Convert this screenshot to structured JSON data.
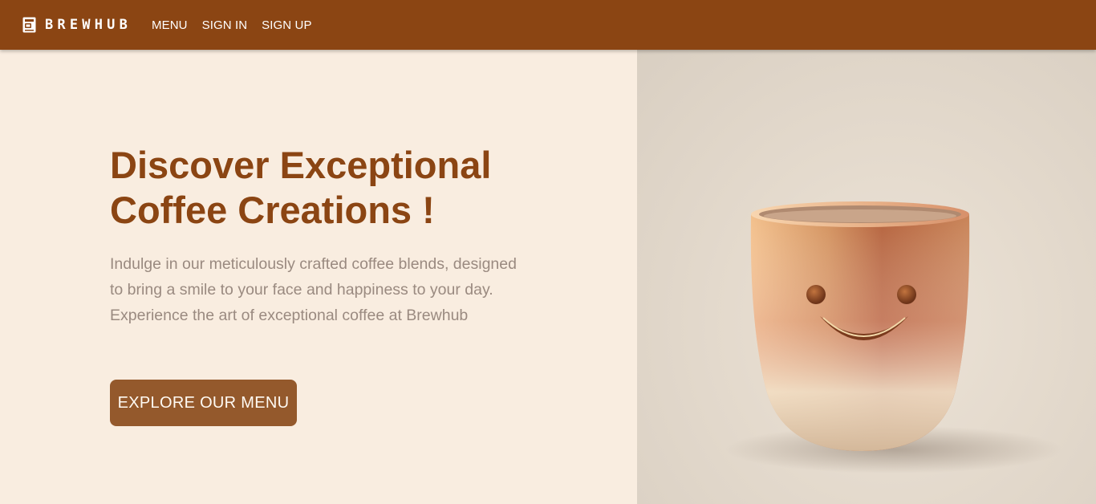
{
  "navbar": {
    "brand_name": "BREWHUB",
    "brand_icon": "coffee-machine-icon",
    "links": [
      {
        "label": "MENU"
      },
      {
        "label": "SIGN IN"
      },
      {
        "label": "SIGN UP"
      }
    ]
  },
  "hero": {
    "title_line1": "Discover Exceptional",
    "title_line2": "Coffee Creations !",
    "description": "Indulge in our meticulously crafted coffee blends, designed to bring a smile to your face and happiness to your day. Experience the art of exceptional coffee at Brewhub",
    "cta_label": "EXPLORE OUR MENU",
    "image_subject": "smiling-coffee-cup-illustration"
  },
  "colors": {
    "navbar_bg": "#8b4513",
    "page_bg": "#f9ede0",
    "title": "#8b4513",
    "description": "#9a8a80",
    "button_bg": "#94592c",
    "button_text": "#fffaf3"
  }
}
